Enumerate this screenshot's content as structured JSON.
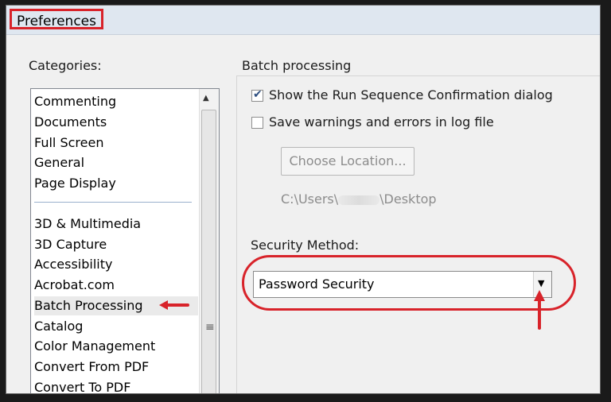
{
  "window": {
    "title": "Preferences"
  },
  "categories": {
    "label": "Categories:",
    "items_top": [
      "Commenting",
      "Documents",
      "Full Screen",
      "General",
      "Page Display"
    ],
    "items_bottom": [
      "3D & Multimedia",
      "3D Capture",
      "Accessibility",
      "Acrobat.com",
      "Batch Processing",
      "Catalog",
      "Color Management",
      "Convert From PDF",
      "Convert To PDF"
    ],
    "selected": "Batch Processing"
  },
  "batch": {
    "group_title": "Batch processing",
    "checkbox1_label": "Show the Run Sequence Confirmation dialog",
    "checkbox1_checked": true,
    "checkbox2_label": "Save warnings and errors in log file",
    "checkbox2_checked": false,
    "choose_location_label": "Choose Location...",
    "path_prefix": "C:\\Users\\",
    "path_suffix": "\\Desktop",
    "security_method_label": "Security Method:",
    "security_method_value": "Password Security"
  },
  "colors": {
    "annotation_red": "#d8232a",
    "accent": "#2d4e80"
  },
  "icons": {
    "checkmark": "checkmark-icon",
    "dropdown": "chevron-down-icon",
    "scroll_up": "scroll-up-icon",
    "scroll_grip": "scroll-grip-icon"
  }
}
